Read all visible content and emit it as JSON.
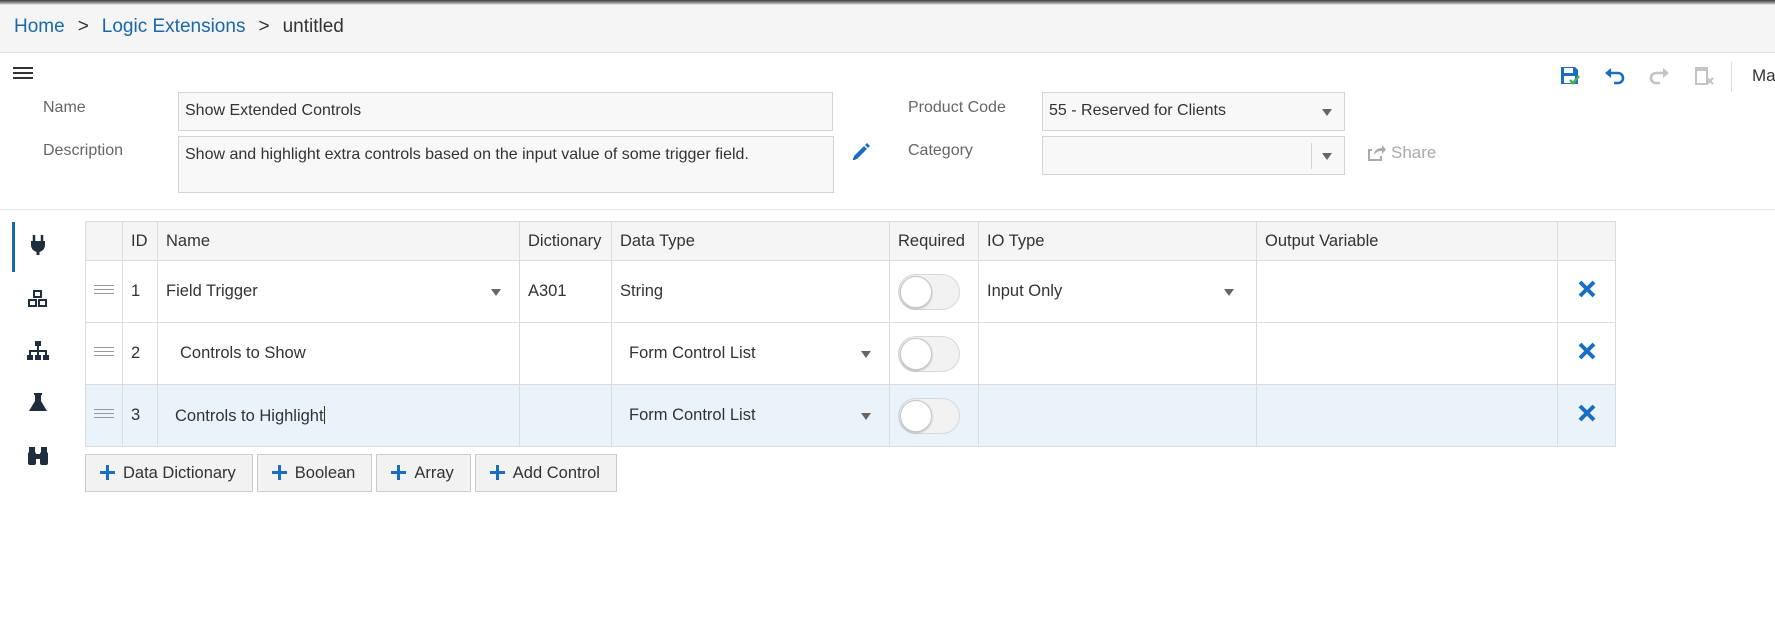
{
  "breadcrumb": {
    "home": "Home",
    "logic_extensions": "Logic Extensions",
    "separator": ">",
    "current": "untitled"
  },
  "toolbar": {
    "overflow_text": "Ma",
    "icons": [
      "save-icon",
      "undo-icon",
      "redo-icon",
      "delete-icon"
    ]
  },
  "form": {
    "name_label": "Name",
    "name_value": "Show Extended Controls",
    "description_label": "Description",
    "description_value": "Show and highlight extra controls based on the input value of some trigger field.",
    "product_code_label": "Product Code",
    "product_code_value": "55 - Reserved for Clients",
    "category_label": "Category",
    "category_value": "",
    "share_label": "Share"
  },
  "sidebar": {
    "items": [
      "plug-icon",
      "cubes-icon",
      "sitemap-icon",
      "flask-icon",
      "binoculars-icon"
    ],
    "active": "plug-icon"
  },
  "grid": {
    "headers": {
      "id": "ID",
      "name": "Name",
      "dictionary": "Dictionary",
      "data_type": "Data Type",
      "required": "Required",
      "io_type": "IO Type",
      "output_variable": "Output Variable"
    },
    "rows": [
      {
        "id": "1",
        "name": "Field Trigger",
        "dictionary": "A301",
        "data_type": "String",
        "required": false,
        "io_type": "Input Only",
        "output_variable": ""
      },
      {
        "id": "2",
        "name": "Controls to Show",
        "dictionary": "",
        "data_type": "Form Control List",
        "required": false,
        "io_type": "",
        "output_variable": ""
      },
      {
        "id": "3",
        "name": "Controls to Highlight",
        "dictionary": "",
        "data_type": "Form Control List",
        "required": false,
        "io_type": "",
        "output_variable": ""
      }
    ]
  },
  "buttons": {
    "data_dictionary": "Data Dictionary",
    "boolean": "Boolean",
    "array": "Array",
    "add_control": "Add Control"
  },
  "colors": {
    "link": "#1a67ab",
    "accent_blue": "#1a6ec2",
    "selected_row": "#eaf3fa",
    "save_check": "#4caf50"
  }
}
